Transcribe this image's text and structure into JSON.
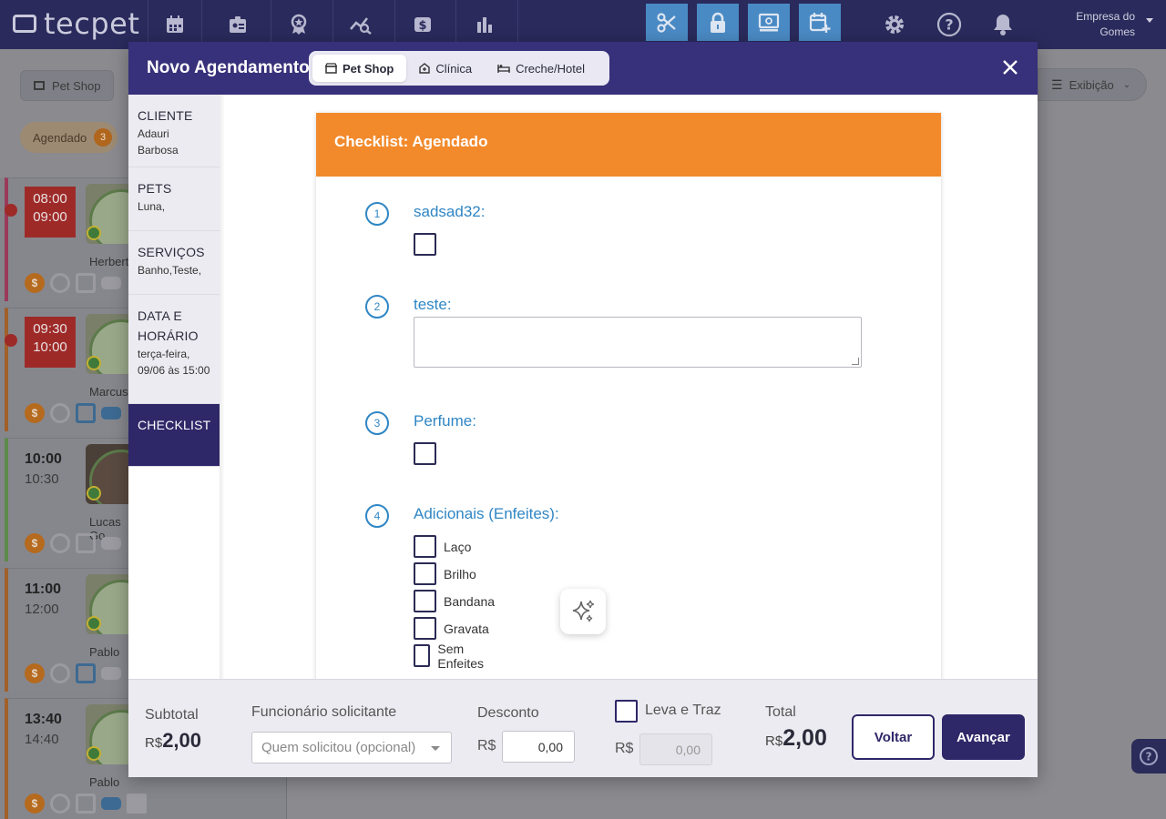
{
  "app": {
    "logo_text": "tecpet",
    "company_line1": "Empresa do",
    "company_line2": "Gomes"
  },
  "nav": {
    "icons": [
      "calendar-icon",
      "badge-icon",
      "award-icon",
      "analytics-icon",
      "cash-icon",
      "bar-chart-icon"
    ],
    "highlight_icons": [
      "scissors-icon",
      "lock-icon",
      "screen-icon",
      "calendar-add-icon"
    ],
    "right_icons": [
      "gear-icon",
      "help-icon",
      "bell-icon"
    ]
  },
  "background": {
    "shop_button": "Pet Shop",
    "status_pill": "Agendado",
    "status_count": "3",
    "view_button": "Exibição",
    "appointments": [
      {
        "start": "08:00",
        "end": "09:00",
        "owner": "Herbert",
        "late": true
      },
      {
        "start": "09:30",
        "end": "10:00",
        "owner": "Marcus",
        "late": true
      },
      {
        "start": "10:00",
        "end": "10:30",
        "owner": "Lucas Go",
        "late": false
      },
      {
        "start": "11:00",
        "end": "12:00",
        "owner": "Pablo",
        "late": false
      },
      {
        "start": "13:40",
        "end": "14:40",
        "owner": "Pablo",
        "late": false
      }
    ],
    "coin_symbol": "$"
  },
  "modal": {
    "title": "Novo Agendamento",
    "tabs": [
      {
        "label": "Pet Shop",
        "active": true
      },
      {
        "label": "Clínica",
        "active": false
      },
      {
        "label": "Creche/Hotel",
        "active": false
      }
    ],
    "steps": [
      {
        "title": "CLIENTE",
        "value": "Adauri Barbosa"
      },
      {
        "title": "PETS",
        "value": "Luna,"
      },
      {
        "title": "SERVIÇOS",
        "value": "Banho,Teste,"
      },
      {
        "title": "DATA E HORÁRIO",
        "value": "terça-feira, 09/06 às 15:00"
      },
      {
        "title": "CHECKLIST",
        "value": ""
      }
    ],
    "checklist": {
      "header": "Checklist: Agendado",
      "questions": [
        {
          "num": "1",
          "label": "sadsad32:"
        },
        {
          "num": "2",
          "label": "teste:"
        },
        {
          "num": "3",
          "label": "Perfume:"
        },
        {
          "num": "4",
          "label": "Adicionais (Enfeites):"
        }
      ],
      "options": [
        "Laço",
        "Brilho",
        "Bandana",
        "Gravata",
        "Sem Enfeites"
      ]
    },
    "footer": {
      "subtotal_label": "Subtotal",
      "subtotal_currency": "R$",
      "subtotal_value": "2,00",
      "requester_label": "Funcionário solicitante",
      "requester_placeholder": "Quem solicitou (opcional)",
      "discount_label": "Desconto",
      "discount_currency": "R$",
      "discount_value": "0,00",
      "pickup_label": "Leva e Traz",
      "pickup_currency": "R$",
      "pickup_value": "0,00",
      "total_label": "Total",
      "total_currency": "R$",
      "total_value": "2,00",
      "back_button": "Voltar",
      "next_button": "Avançar"
    }
  },
  "colors": {
    "primary": "#2e2768",
    "header": "#37307a",
    "orange": "#f28a2c",
    "blue": "#2f86c4"
  }
}
